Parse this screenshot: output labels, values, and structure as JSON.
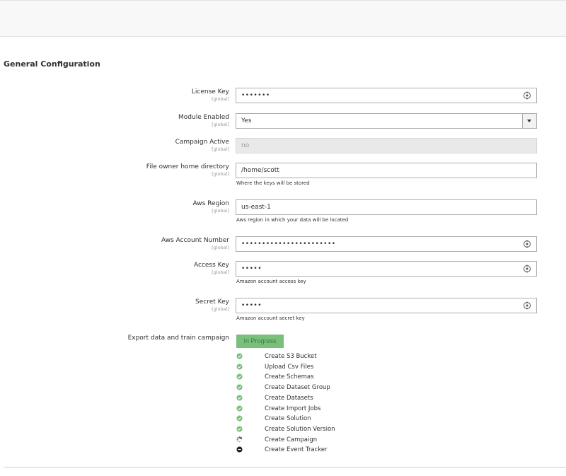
{
  "section": {
    "title": "General Configuration"
  },
  "fields": {
    "license_key": {
      "label": "License Key",
      "scope": "[global]",
      "value": "•••••••"
    },
    "module_enabled": {
      "label": "Module Enabled",
      "scope": "[global]",
      "value": "Yes"
    },
    "campaign_active": {
      "label": "Campaign Active",
      "scope": "[global]",
      "value": "no"
    },
    "home_dir": {
      "label": "File owner home directory",
      "scope": "[global]",
      "value": "/home/scott",
      "note": "Where the keys will be stored"
    },
    "aws_region": {
      "label": "Aws Region",
      "scope": "[global]",
      "value": "us-east-1",
      "note": "Aws region in which your data will be located"
    },
    "aws_account": {
      "label": "Aws Account Number",
      "scope": "[global]",
      "value": "•••••••••••••••••••••••"
    },
    "access_key": {
      "label": "Access Key",
      "scope": "[global]",
      "value": "•••••",
      "note": "Amazon account access key"
    },
    "secret_key": {
      "label": "Secret Key",
      "scope": "[global]",
      "value": "•••••",
      "note": "Amazon account secret key"
    }
  },
  "export": {
    "label": "Export data and train campaign",
    "button": "In Progress",
    "steps": [
      {
        "label": "Create S3 Bucket",
        "status": "done"
      },
      {
        "label": "Upload Csv Files",
        "status": "done"
      },
      {
        "label": "Create Schemas",
        "status": "done"
      },
      {
        "label": "Create Dataset Group",
        "status": "done"
      },
      {
        "label": "Create Datasets",
        "status": "done"
      },
      {
        "label": "Create Import Jobs",
        "status": "done"
      },
      {
        "label": "Create Solution",
        "status": "done"
      },
      {
        "label": "Create Solution Version",
        "status": "done"
      },
      {
        "label": "Create Campaign",
        "status": "loading"
      },
      {
        "label": "Create Event Tracker",
        "status": "pending"
      }
    ]
  },
  "colors": {
    "done": "#79c07a",
    "pending": "#1a1a1a",
    "button": "#79c07a"
  }
}
